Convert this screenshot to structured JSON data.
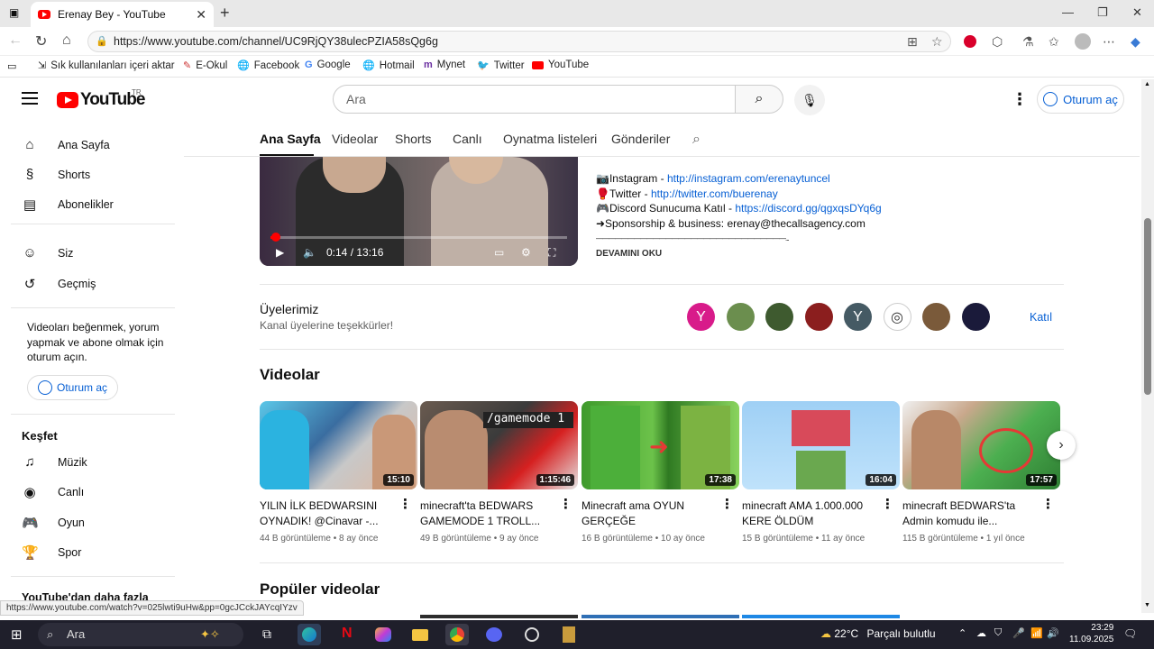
{
  "browser": {
    "tab_title": "Erenay Bey - YouTube",
    "url": "https://www.youtube.com/channel/UC9RjQY38ulecPZIA58sQg6g",
    "status_url": "https://www.youtube.com/watch?v=025lwti9uHw&pp=0gcJCckJAYcqIYzv",
    "bookmarks": [
      "Sık kullanılanları içeri aktar",
      "E-Okul",
      "Facebook",
      "Google",
      "Hotmail",
      "Mynet",
      "Twitter",
      "YouTube"
    ]
  },
  "header": {
    "logo_text": "YouTube",
    "logo_region": "TR",
    "search_placeholder": "Ara",
    "signin_label": "Oturum aç"
  },
  "sidebar": {
    "items": [
      {
        "label": "Ana Sayfa",
        "icon": "home-icon"
      },
      {
        "label": "Shorts",
        "icon": "shorts-icon"
      },
      {
        "label": "Abonelikler",
        "icon": "subscriptions-icon"
      },
      {
        "label": "Siz",
        "icon": "you-icon"
      },
      {
        "label": "Geçmiş",
        "icon": "history-icon"
      }
    ],
    "note": "Videoları beğenmek, yorum yapmak ve abone olmak için oturum açın.",
    "signin_label": "Oturum aç",
    "explore_title": "Keşfet",
    "explore": [
      {
        "label": "Müzik",
        "icon": "music-icon"
      },
      {
        "label": "Canlı",
        "icon": "live-icon"
      },
      {
        "label": "Oyun",
        "icon": "gaming-icon"
      },
      {
        "label": "Spor",
        "icon": "trophy-icon"
      }
    ],
    "more_title": "YouTube'dan daha fazla"
  },
  "channel_tabs": [
    "Ana Sayfa",
    "Videolar",
    "Shorts",
    "Canlı",
    "Oynatma listeleri",
    "Gönderiler"
  ],
  "player": {
    "time": "0:14 / 13:16",
    "progress": 0.018
  },
  "description": {
    "instagram_label": "📷Instagram - ",
    "instagram_link": "http://instagram.com/erenaytuncel",
    "twitter_label": "🥊Twitter - ",
    "twitter_link": "http://twitter.com/buerenay",
    "discord_label": "🎮Discord Sunucuma Katıl - ",
    "discord_link": "https://discord.gg/qgxqsDYq6g",
    "sponsor": "➜Sponsorship & business: erenay@thecallsagency.com",
    "divider": "——————————————————————————————...",
    "read_more": "DEVAMINI OKU"
  },
  "members": {
    "title": "Üyelerimiz",
    "subtitle": "Kanal üyelerine teşekkürler!",
    "avatars": [
      {
        "letter": "Y",
        "color": "#d81b8a"
      },
      {
        "letter": "",
        "color": "#6b8e4e"
      },
      {
        "letter": "",
        "color": "#3e5a2f"
      },
      {
        "letter": "",
        "color": "#8b1e1e"
      },
      {
        "letter": "Y",
        "color": "#455a64"
      },
      {
        "letter": "",
        "color": "#ffffff"
      },
      {
        "letter": "",
        "color": "#7a5a3a"
      },
      {
        "letter": "",
        "color": "#1a1a3a"
      }
    ],
    "join_label": "Katıl"
  },
  "videos_section": {
    "title": "Videolar",
    "videos": [
      {
        "title": "YILIN İLK BEDWARSINI OYNADIK! @Cinavar -...",
        "views": "44 B görüntüleme",
        "age": "8 ay önce",
        "duration": "15:10"
      },
      {
        "title": "minecraft'ta BEDWARS GAMEMODE 1 TROLL...",
        "views": "49 B görüntüleme",
        "age": "9 ay önce",
        "duration": "1:15:46",
        "overlay": "/gamemode 1"
      },
      {
        "title": "Minecraft ama OYUN GERÇEĞE DÖNÜŞÜYOR...…",
        "views": "16 B görüntüleme",
        "age": "10 ay önce",
        "duration": "17:38"
      },
      {
        "title": "minecraft AMA 1.000.000 KERE ÖLDÜM",
        "views": "15 B görüntüleme",
        "age": "11 ay önce",
        "duration": "16:04"
      },
      {
        "title": "minecraft BEDWARS'ta Admin komudu ile...",
        "views": "115 B görüntüleme",
        "age": "1 yıl önce",
        "duration": "17:57"
      }
    ]
  },
  "popular_title": "Popüler videolar",
  "taskbar": {
    "search": "Ara",
    "weather_temp": "22°C",
    "weather_text": "Parçalı bulutlu",
    "time": "23:29",
    "date": "11.09.2025"
  }
}
